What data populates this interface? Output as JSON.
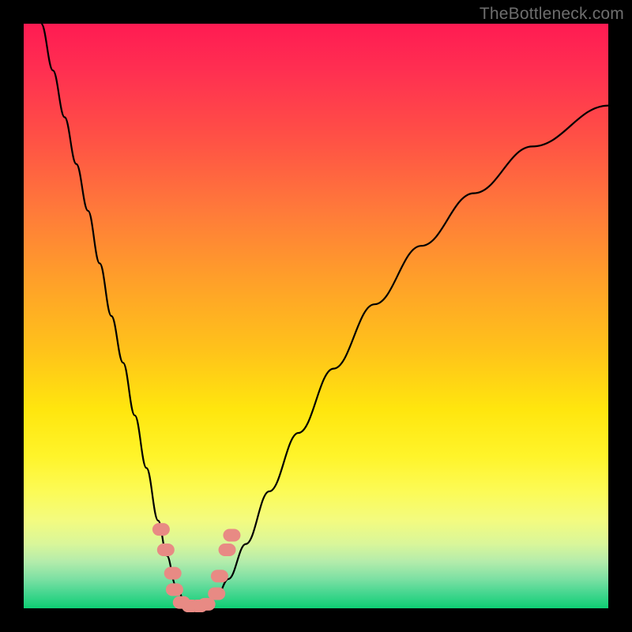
{
  "watermark": "TheBottleneck.com",
  "chart_data": {
    "type": "line",
    "title": "",
    "xlabel": "",
    "ylabel": "",
    "xlim": [
      0,
      100
    ],
    "ylim": [
      0,
      100
    ],
    "grid": false,
    "legend": false,
    "background": "rainbow-gradient-red-to-green",
    "series": [
      {
        "name": "bottleneck-curve",
        "style": "solid-black",
        "x": [
          3,
          5,
          7,
          9,
          11,
          13,
          15,
          17,
          19,
          21,
          23,
          24.5,
          26,
          27.5,
          29,
          30.5,
          31.5,
          33,
          35,
          38,
          42,
          47,
          53,
          60,
          68,
          77,
          87,
          100
        ],
        "y": [
          100,
          92,
          84,
          76,
          68,
          59,
          50,
          42,
          33,
          24,
          15,
          9,
          4,
          1.3,
          0.4,
          0.3,
          0.6,
          2,
          5,
          11,
          20,
          30,
          41,
          52,
          62,
          71,
          79,
          86
        ]
      }
    ],
    "markers": {
      "name": "highlight-dots",
      "style": "salmon-rounded",
      "points": [
        {
          "x": 23.5,
          "y": 13.5
        },
        {
          "x": 24.3,
          "y": 10.0
        },
        {
          "x": 25.5,
          "y": 6.0
        },
        {
          "x": 25.8,
          "y": 3.2
        },
        {
          "x": 27.0,
          "y": 1.0
        },
        {
          "x": 28.5,
          "y": 0.4
        },
        {
          "x": 30.0,
          "y": 0.4
        },
        {
          "x": 31.3,
          "y": 0.7
        },
        {
          "x": 33.0,
          "y": 2.5
        },
        {
          "x": 33.5,
          "y": 5.5
        },
        {
          "x": 34.8,
          "y": 10.0
        },
        {
          "x": 35.6,
          "y": 12.5
        }
      ]
    }
  }
}
